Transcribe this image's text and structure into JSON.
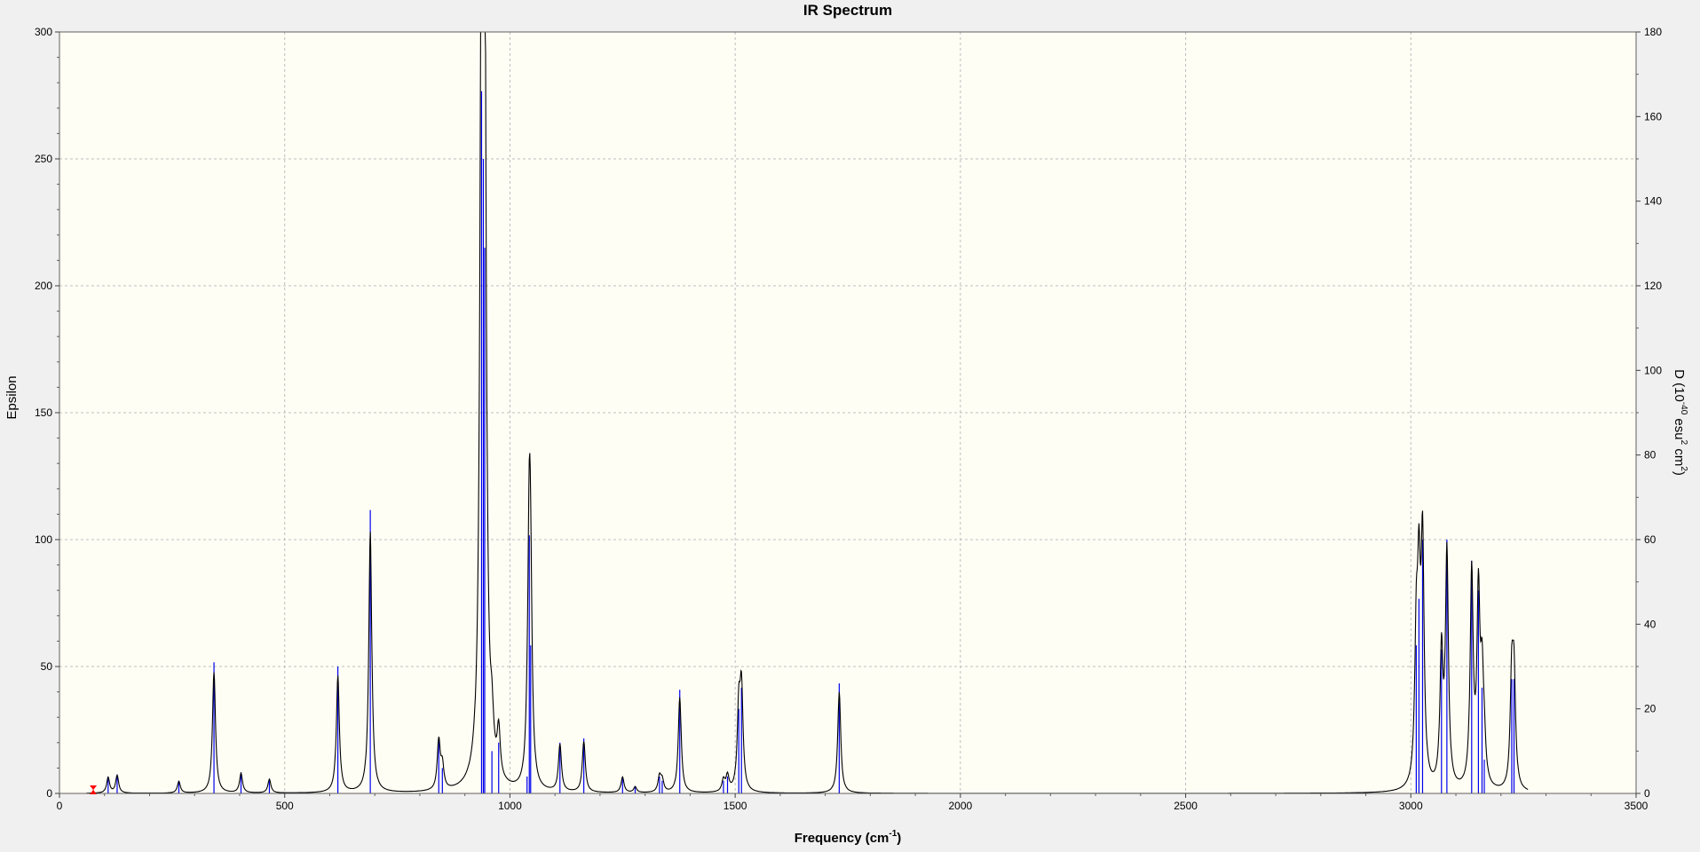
{
  "chart_data": {
    "type": "line",
    "title": "IR Spectrum",
    "xlabel": {
      "base": "Frequency (cm",
      "sup": "-1",
      "tail": ")"
    },
    "ylabel_left": "Epsilon",
    "ylabel_right": {
      "parts": [
        "D (10",
        "-40",
        " esu",
        "2",
        " cm",
        "2",
        ")"
      ]
    },
    "xlim": [
      0,
      3500
    ],
    "ylim_left": [
      0,
      300
    ],
    "ylim_right": [
      0,
      180
    ],
    "x_ticks": [
      0,
      500,
      1000,
      1500,
      2000,
      2500,
      3000,
      3500
    ],
    "y_left_ticks": [
      0,
      50,
      100,
      150,
      200,
      250,
      300
    ],
    "y_right_ticks": [
      0,
      20,
      40,
      60,
      80,
      100,
      120,
      140,
      160,
      180
    ],
    "x_grid": [
      500,
      1000,
      1500,
      2000,
      2500,
      3000
    ],
    "y_grid": [
      50,
      100,
      150,
      200,
      250
    ],
    "grid": true,
    "colors": {
      "background": "#f0f0f0",
      "plot_background": "#fffef5",
      "spectrum": "#000000",
      "stick": "#0000ee",
      "grid": "#bdbdbd",
      "marker": "#ff0000"
    },
    "series": [
      {
        "kind": "spectrum",
        "units": "Epsilon (left axis)",
        "peak_width_hwhm": 4
      },
      {
        "kind": "sticks",
        "units": "D 10^-40 esu^2 cm^2 (right axis)",
        "x": [
          108,
          128,
          265,
          343,
          403,
          466,
          618,
          690,
          842,
          850,
          937,
          941,
          944,
          960,
          975,
          1038,
          1043,
          1046,
          1111,
          1164,
          1250,
          1278,
          1332,
          1338,
          1377,
          1474,
          1483,
          1508,
          1514,
          1731,
          3012,
          3018,
          3026,
          3068,
          3080,
          3135,
          3150,
          3158,
          3163,
          3224,
          3229
        ],
        "y": [
          4,
          4.5,
          3,
          31,
          5,
          3.5,
          30,
          67,
          12.5,
          6,
          166,
          150,
          129,
          10,
          12,
          4,
          61,
          35,
          12,
          13,
          4,
          1.5,
          4,
          3,
          24.5,
          3,
          4,
          20,
          25,
          26,
          35,
          46,
          60,
          34,
          60,
          55,
          48,
          25,
          8,
          27,
          27
        ]
      }
    ],
    "marker_x": 75
  }
}
